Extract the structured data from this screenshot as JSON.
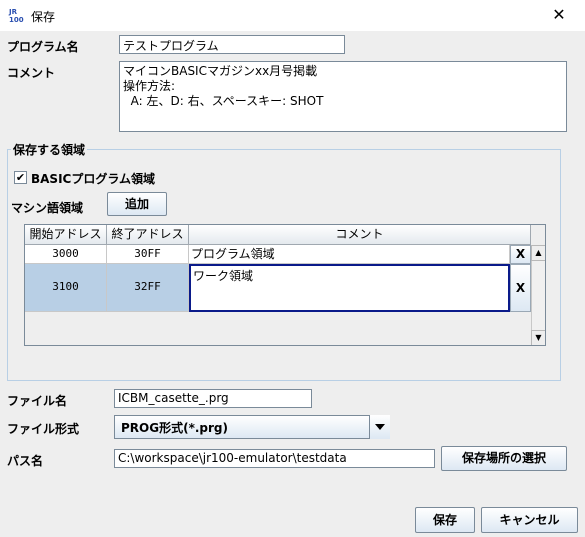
{
  "window": {
    "title": "保存",
    "close_glyph": "✕"
  },
  "form": {
    "program_name_label": "プログラム名",
    "program_name_value": "テストプログラム",
    "comment_label": "コメント",
    "comment_lines": [
      "マイコンBASICマガジンxx月号掲載",
      "操作方法:",
      "  A: 左、D: 右、スペースキー: SHOT"
    ]
  },
  "save_region": {
    "group_title": "保存する領域",
    "basic_checkbox_label": "BASICプログラム領域",
    "basic_checked": true,
    "machine_code_label": "マシン語領域",
    "add_button": "追加",
    "table": {
      "headers": [
        "開始アドレス",
        "終了アドレス",
        "コメント"
      ],
      "rows": [
        {
          "start": "3000",
          "end": "30FF",
          "comment": "プログラム領域",
          "delete": "X"
        },
        {
          "start": "3100",
          "end": "32FF",
          "comment": "ワーク領域",
          "delete": "X"
        }
      ]
    }
  },
  "file": {
    "name_label": "ファイル名",
    "name_value": "ICBM_casette_.prg",
    "format_label": "ファイル形式",
    "format_value": "PROG形式(*.prg)",
    "path_label": "パス名",
    "path_value": "C:\\workspace\\jr100-emulator\\testdata",
    "choose_location_button": "保存場所の選択"
  },
  "actions": {
    "save": "保存",
    "cancel": "キャンセル"
  }
}
